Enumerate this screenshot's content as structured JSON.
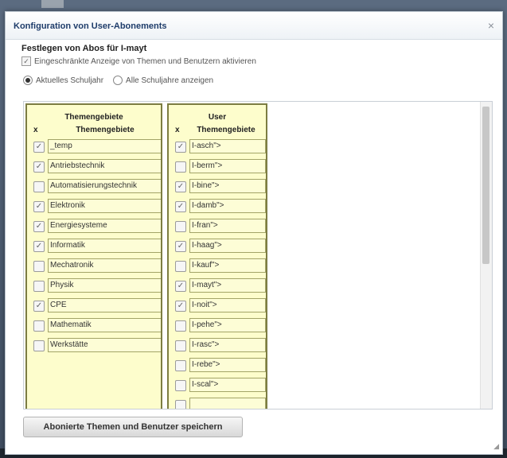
{
  "dialog": {
    "title": "Konfiguration von User-Abonements",
    "close_symbol": "×",
    "heading": "Festlegen von Abos für I-mayt",
    "restricted_checkbox_label": "Eingeschränkte Anzeige von Themen und Benutzern aktivieren",
    "radio_current_label": "Aktuelles Schuljahr",
    "radio_all_label": "Alle Schuljahre anzeigen",
    "save_label": "Abonierte Themen und Benutzer speichern"
  },
  "topics_table": {
    "title": "Themengebiete",
    "col_x": "x",
    "col_name": "Themengebiete",
    "rows": [
      {
        "name": "_temp",
        "checked": true
      },
      {
        "name": "Antriebstechnik",
        "checked": true
      },
      {
        "name": "Automatisierungstechnik",
        "checked": false
      },
      {
        "name": "Elektronik",
        "checked": true
      },
      {
        "name": "Energiesysteme",
        "checked": true
      },
      {
        "name": "Informatik",
        "checked": true
      },
      {
        "name": "Mechatronik",
        "checked": false
      },
      {
        "name": "Physik",
        "checked": false
      },
      {
        "name": "CPE",
        "checked": true
      },
      {
        "name": "Mathematik",
        "checked": false
      },
      {
        "name": "Werkstätte",
        "checked": false
      }
    ]
  },
  "users_table": {
    "title": "User",
    "col_x": "x",
    "col_name": "Themengebiete",
    "rows": [
      {
        "name": "I-asch\">",
        "checked": true
      },
      {
        "name": "I-berm\">",
        "checked": false
      },
      {
        "name": "I-bine\">",
        "checked": true
      },
      {
        "name": "I-damb\">",
        "checked": true
      },
      {
        "name": "I-fran\">",
        "checked": false
      },
      {
        "name": "I-haag\">",
        "checked": true
      },
      {
        "name": "I-kauf\">",
        "checked": false
      },
      {
        "name": "I-mayt\">",
        "checked": true
      },
      {
        "name": "I-noit\">",
        "checked": true
      },
      {
        "name": "I-pehe\">",
        "checked": false
      },
      {
        "name": "I-rasc\">",
        "checked": false
      },
      {
        "name": "I-rebe\">",
        "checked": false
      },
      {
        "name": "I-scal\">",
        "checked": false
      },
      {
        "name": "",
        "checked": false
      }
    ]
  }
}
